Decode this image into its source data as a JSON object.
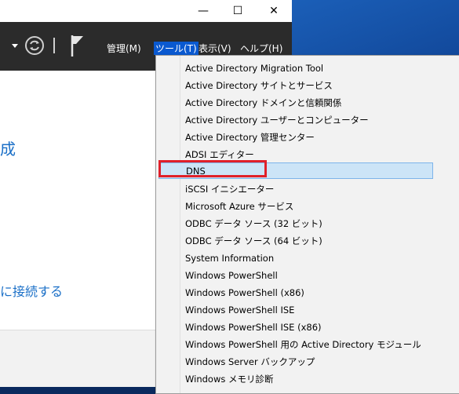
{
  "window": {
    "controls": {
      "minimize": "—",
      "maximize": "☐",
      "close": "✕"
    }
  },
  "toolbar": {
    "menus": [
      {
        "label": "管理(M)"
      },
      {
        "label": "ツール(T)"
      },
      {
        "label": "表示(V)"
      },
      {
        "label": "ヘルプ(H)"
      }
    ]
  },
  "content": {
    "heading_fragment": "成",
    "link_fragment": "に接続する"
  },
  "tools_menu": {
    "items": [
      "Active Directory Migration Tool",
      "Active Directory サイトとサービス",
      "Active Directory ドメインと信頼関係",
      "Active Directory ユーザーとコンピューター",
      "Active Directory 管理センター",
      "ADSI エディター",
      "DNS",
      "iSCSI イニシエーター",
      "Microsoft Azure サービス",
      "ODBC データ ソース (32 ビット)",
      "ODBC データ ソース (64 ビット)",
      "System Information",
      "Windows PowerShell",
      "Windows PowerShell (x86)",
      "Windows PowerShell ISE",
      "Windows PowerShell ISE (x86)",
      "Windows PowerShell 用の Active Directory モジュール",
      "Windows Server バックアップ",
      "Windows メモリ診断"
    ],
    "selected": "DNS"
  },
  "colors": {
    "accent": "#0a59d0",
    "selection": "#cce4f7",
    "annotation": "#e0202a",
    "link": "#1a6fc7"
  }
}
